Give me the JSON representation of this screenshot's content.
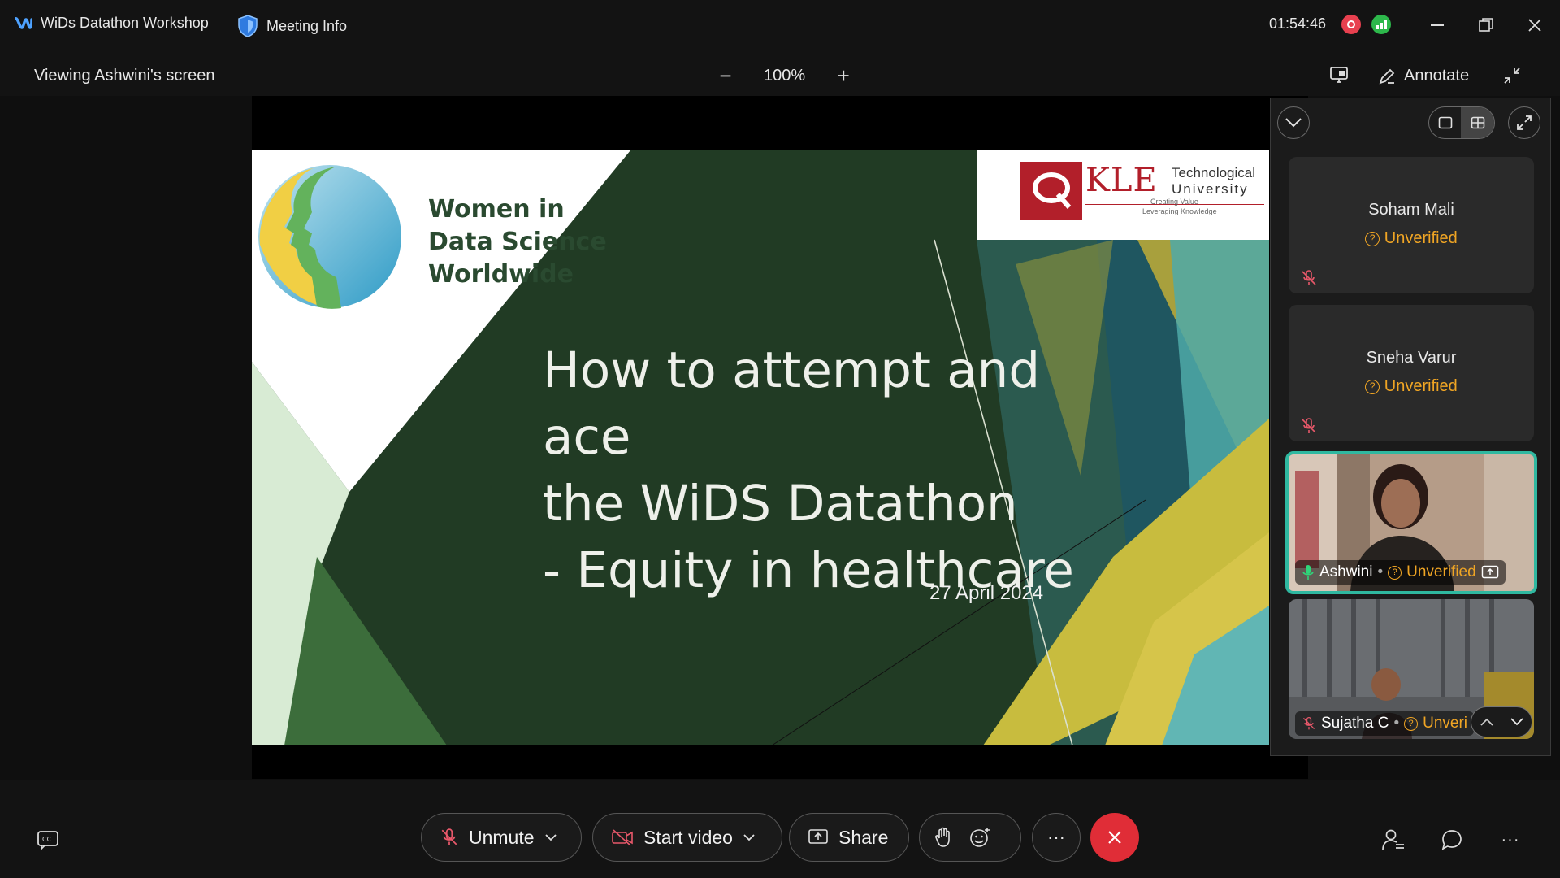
{
  "titlebar": {
    "meeting_title": "WiDs Datathon Workshop",
    "meeting_info": "Meeting Info",
    "clock": "01:54:46"
  },
  "subbar": {
    "viewing": "Viewing Ashwini's screen",
    "zoom_level": "100%",
    "annotate": "Annotate"
  },
  "slide": {
    "title_lines": [
      "How to attempt and ace",
      "the WiDS Datathon",
      "- Equity in healthcare"
    ],
    "date": "27 April 2024",
    "wids_lines": [
      "Women in",
      "Data Science",
      "Worldwide"
    ],
    "kle_name": "KLE",
    "kle_tech": "Technological",
    "kle_univ": "University",
    "kle_tag1": "Creating Value",
    "kle_tag2": "Leveraging Knowledge"
  },
  "participants": [
    {
      "name": "Soham Mali",
      "status": "Unverified"
    },
    {
      "name": "Sneha Varur",
      "status": "Unverified"
    },
    {
      "name": "Ashwini",
      "status": "Unverified"
    },
    {
      "name": "Sujatha C",
      "status": "Unveri"
    }
  ],
  "controls": {
    "unmute": "Unmute",
    "start_video": "Start video",
    "share": "Share",
    "more": "···"
  },
  "colors": {
    "accent_green": "#2fb8a0",
    "unverified": "#f0a524",
    "leave_red": "#e02d37",
    "recording_red": "#e8404f",
    "signal_green": "#2db84b"
  }
}
